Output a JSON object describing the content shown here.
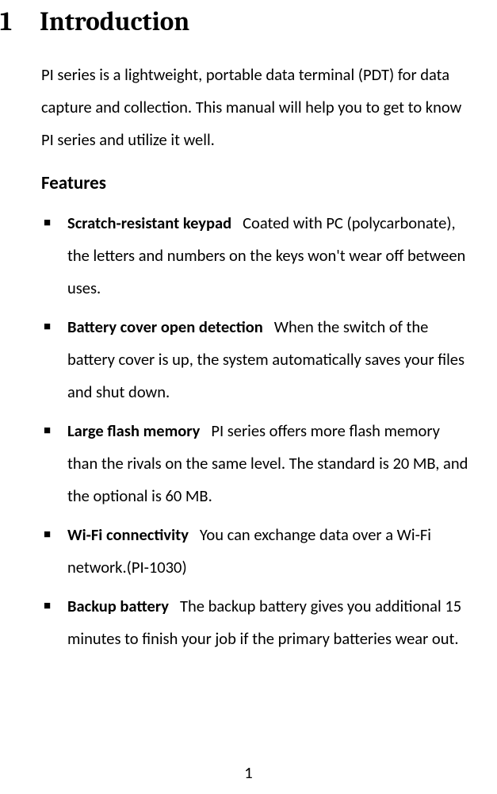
{
  "heading": {
    "number": "1",
    "title": "Introduction"
  },
  "intro": "PI series is a lightweight, portable data terminal (PDT) for data capture and collection. This manual will help you to get to know PI series and utilize it well.",
  "features_heading": "Features",
  "features": [
    {
      "title": "Scratch-resistant keypad",
      "desc": "Coated with PC (polycarbonate), the letters and numbers on the keys won't wear off between uses."
    },
    {
      "title": "Battery cover open detection",
      "desc": "When the switch of the battery cover is up, the system automatically saves your files and shut down."
    },
    {
      "title": "Large flash memory",
      "desc": "PI series offers more flash memory than the rivals on the same level. The standard is 20 MB, and the optional is 60 MB."
    },
    {
      "title": "Wi-Fi connectivity",
      "desc": "You can exchange data over a Wi-Fi network.(PI-1030)"
    },
    {
      "title": "Backup battery",
      "desc": "The backup battery gives you additional 15 minutes to finish your job if the primary batteries wear out."
    }
  ],
  "page_number": "1"
}
